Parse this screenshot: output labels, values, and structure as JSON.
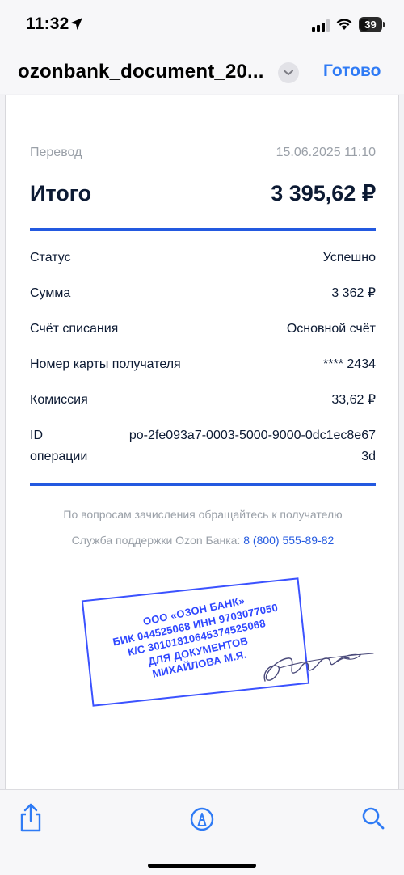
{
  "status_bar": {
    "time": "11:32",
    "battery": "39"
  },
  "nav": {
    "document_title": "ozonbank_document_20...",
    "done_label": "Готово"
  },
  "receipt": {
    "type": "Перевод",
    "datetime": "15.06.2025 11:10",
    "total_label": "Итого",
    "total_value": "3 395,62 ₽",
    "details": [
      {
        "label": "Статус",
        "value": "Успешно"
      },
      {
        "label": "Сумма",
        "value": "3 362 ₽"
      },
      {
        "label": "Счёт списания",
        "value": "Основной счёт"
      },
      {
        "label": "Номер карты получателя",
        "value": "**** 2434"
      },
      {
        "label": "Комиссия",
        "value": "33,62 ₽"
      },
      {
        "label": "ID операции",
        "value": "po-2fe093a7-0003-5000-9000-0dc1ec8e673d"
      }
    ],
    "footnote_1": "По вопросам зачисления обращайтесь к получателю",
    "footnote_2_prefix": "Служба поддержки Ozon Банка: ",
    "support_phone": "8 (800) 555-89-82"
  },
  "stamp": {
    "lines": [
      "ООО «ОЗОН БАНК»",
      "БИК 044525068 ИНН 9703077050",
      "К/С 30101810645374525068",
      "ДЛЯ ДОКУМЕНТОВ",
      "МИХАЙЛОВА М.Я."
    ]
  },
  "toolbar": {
    "icons": [
      "share-icon",
      "markup-icon",
      "search-icon"
    ]
  },
  "colors": {
    "accent_blue": "#2359e0",
    "ios_link": "#2f7bf5",
    "stamp_blue": "#2f47ff",
    "muted_text": "#9aa0a8",
    "dark_text": "#0c1a33"
  }
}
